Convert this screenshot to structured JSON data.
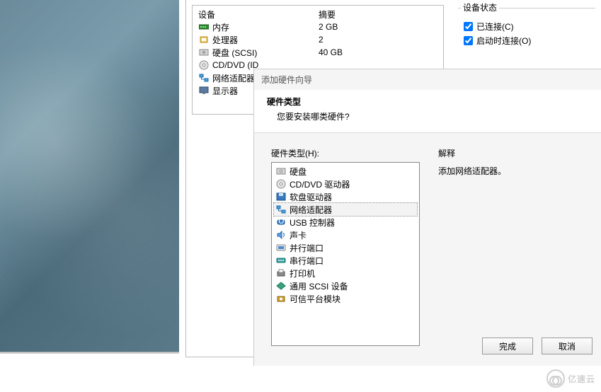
{
  "desktop": {},
  "panel": {
    "headers": {
      "device": "设备",
      "summary": "摘要"
    },
    "devices": [
      {
        "icon": "memory-icon",
        "name": "内存",
        "value": "2 GB"
      },
      {
        "icon": "cpu-icon",
        "name": "处理器",
        "value": "2"
      },
      {
        "icon": "disk-icon",
        "name": "硬盘 (SCSI)",
        "value": "40 GB"
      },
      {
        "icon": "optical-icon",
        "name": "CD/DVD (ID",
        "value": ""
      },
      {
        "icon": "network-icon",
        "name": "网络适配器",
        "value": ""
      },
      {
        "icon": "display-icon",
        "name": "显示器",
        "value": ""
      }
    ],
    "status": {
      "legend": "设备状态",
      "connected": {
        "label": "已连接(C)",
        "checked": true
      },
      "connect_at_poweron": {
        "label": "启动时连接(O)",
        "checked": true
      }
    }
  },
  "wizard": {
    "title": "添加硬件向导",
    "heading": "硬件类型",
    "subheading": "您要安装哪类硬件?",
    "list_label": "硬件类型(H):",
    "explain_label": "解释",
    "explain_text": "添加网络适配器。",
    "items": [
      {
        "icon": "disk-icon",
        "label": "硬盘",
        "selected": false
      },
      {
        "icon": "optical-icon",
        "label": "CD/DVD 驱动器",
        "selected": false
      },
      {
        "icon": "floppy-icon",
        "label": "软盘驱动器",
        "selected": false
      },
      {
        "icon": "network-icon",
        "label": "网络适配器",
        "selected": true
      },
      {
        "icon": "usb-icon",
        "label": "USB 控制器",
        "selected": false
      },
      {
        "icon": "sound-icon",
        "label": "声卡",
        "selected": false
      },
      {
        "icon": "parallel-icon",
        "label": "并行端口",
        "selected": false
      },
      {
        "icon": "serial-icon",
        "label": "串行端口",
        "selected": false
      },
      {
        "icon": "printer-icon",
        "label": "打印机",
        "selected": false
      },
      {
        "icon": "scsi-icon",
        "label": "通用 SCSI 设备",
        "selected": false
      },
      {
        "icon": "tpm-icon",
        "label": "可信平台模块",
        "selected": false
      }
    ],
    "buttons": {
      "finish": "完成",
      "cancel": "取消"
    }
  },
  "watermark": "亿速云"
}
